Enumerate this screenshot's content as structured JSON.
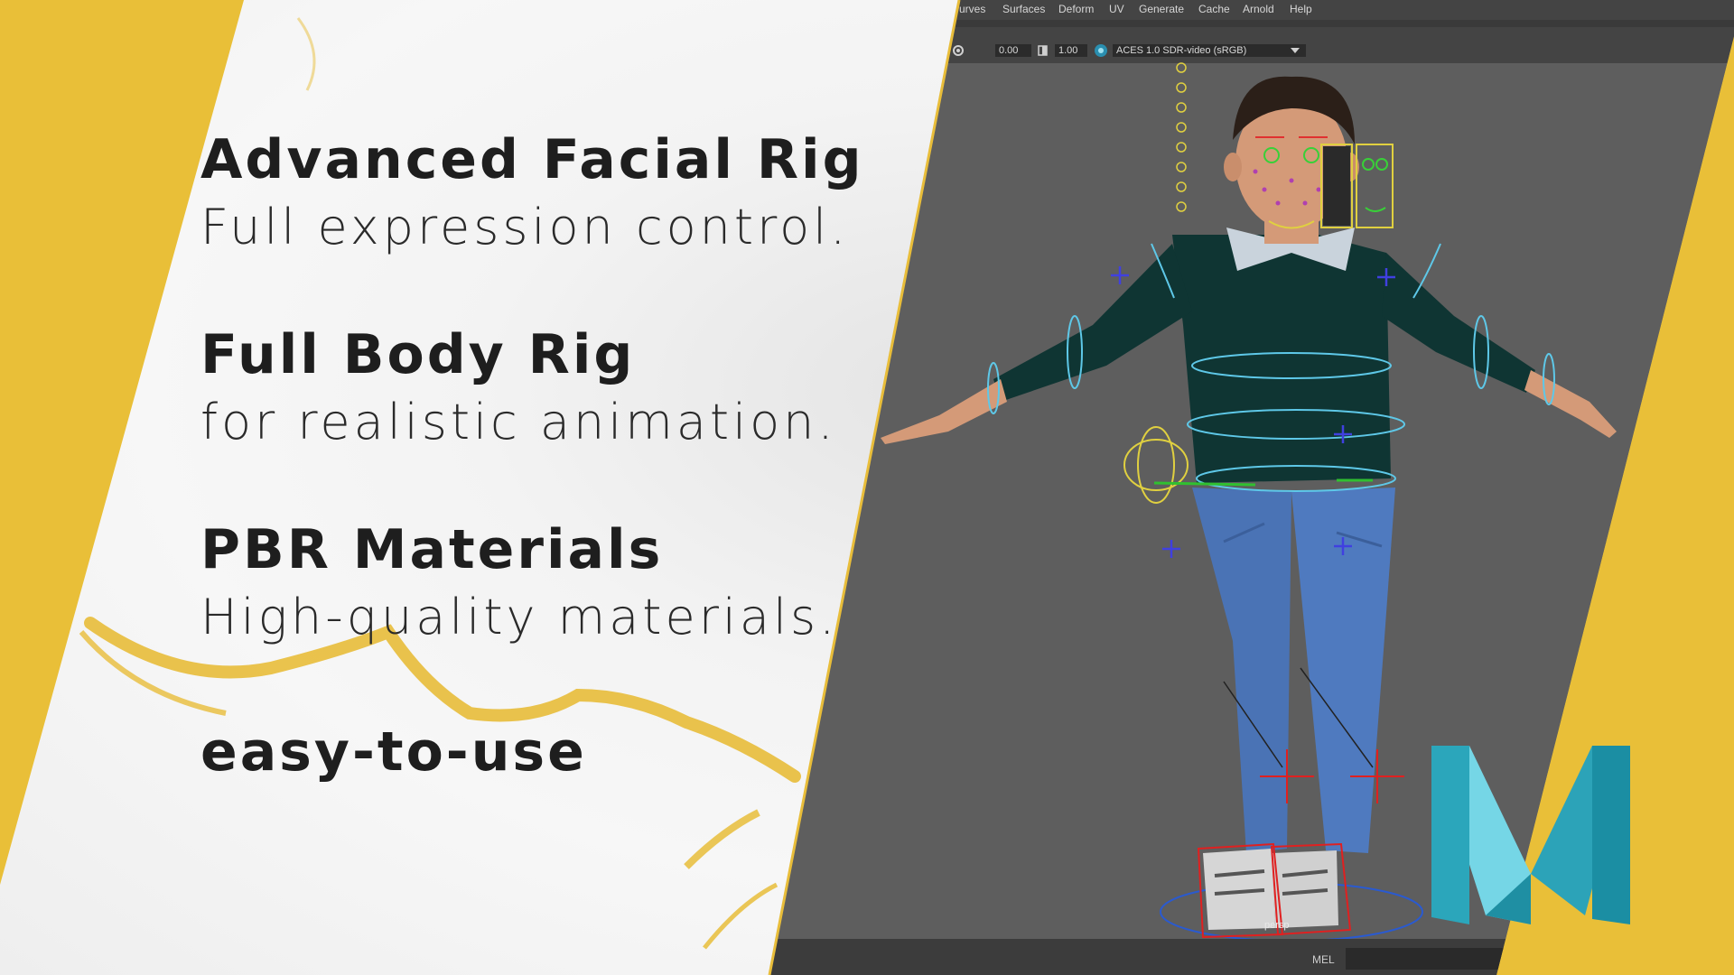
{
  "features": [
    {
      "title": "Advanced Facial Rig",
      "subtitle": "Full expression control."
    },
    {
      "title": "Full Body Rig",
      "subtitle": "for realistic animation."
    },
    {
      "title": "PBR Materials",
      "subtitle": "High-quality materials."
    }
  ],
  "tagline": "easy-to-use",
  "maya": {
    "menu": [
      "urves",
      "Surfaces",
      "Deform",
      "UV",
      "Generate",
      "Cache",
      "Arnold",
      "Help"
    ],
    "toolbar": {
      "field_a": "0.00",
      "field_b": "1.00",
      "color_space": "ACES 1.0 SDR-video (sRGB)"
    },
    "camera_label": "persp",
    "command_label": "MEL"
  },
  "colors": {
    "gold": "#e9bf38",
    "maya_teal": "#38b6c8",
    "viewport": "#5e5e5e"
  },
  "icons": [
    "maya-logo-icon",
    "dropdown-arrow-icon",
    "exposure-icon",
    "gamma-icon",
    "color-management-icon"
  ]
}
